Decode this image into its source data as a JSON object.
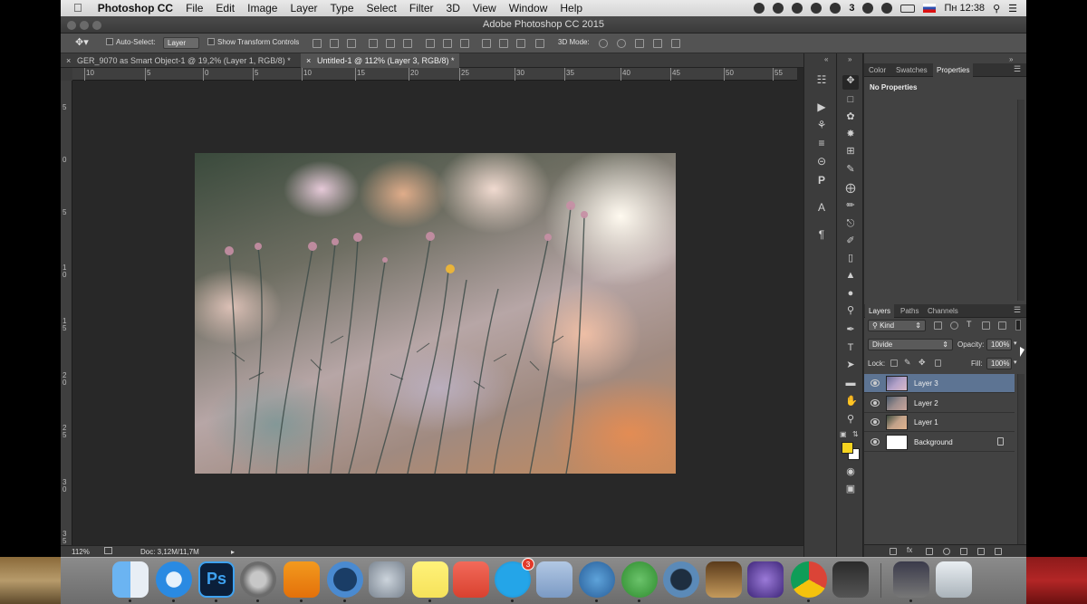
{
  "menubar": {
    "app_name": "Photoshop CC",
    "items": [
      "File",
      "Edit",
      "Image",
      "Layer",
      "Type",
      "Select",
      "Filter",
      "3D",
      "View",
      "Window",
      "Help"
    ],
    "notification_count": "3",
    "input_flag": "ru-flag-icon",
    "clock": "Пн 12:38"
  },
  "window": {
    "title": "Adobe Photoshop CC 2015"
  },
  "options_bar": {
    "auto_select_label": "Auto-Select:",
    "auto_select_value": "Layer",
    "show_transform_label": "Show Transform Controls",
    "mode_3d_label": "3D Mode:"
  },
  "tabs": [
    {
      "label": "GER_9070 as Smart Object-1 @ 19,2% (Layer 1, RGB/8) *",
      "active": false
    },
    {
      "label": "Untitled-1 @ 112% (Layer 3, RGB/8) *",
      "active": true
    }
  ],
  "ruler": {
    "h_ticks": [
      "10",
      "5",
      "0",
      "5",
      "10",
      "15",
      "20",
      "25",
      "30",
      "35",
      "40",
      "45",
      "50",
      "55"
    ],
    "v_ticks": [
      "5",
      "0",
      "5",
      "1\n0",
      "1\n5",
      "2\n0",
      "2\n5",
      "3\n0",
      "3\n5"
    ]
  },
  "status_bar": {
    "zoom": "112%",
    "doc_info": "Doc: 3,12M/11,7M"
  },
  "properties_panel": {
    "tabs": [
      "Color",
      "Swatches",
      "Properties"
    ],
    "active_tab": "Properties",
    "message": "No Properties"
  },
  "layers_panel": {
    "tabs": [
      "Layers",
      "Paths",
      "Channels"
    ],
    "active_tab": "Layers",
    "filter_kind": "Kind",
    "blend_mode": "Divide",
    "opacity_label": "Opacity:",
    "opacity_value": "100%",
    "lock_label": "Lock:",
    "fill_label": "Fill:",
    "fill_value": "100%",
    "layers": [
      {
        "name": "Layer 3",
        "selected": true,
        "locked": false
      },
      {
        "name": "Layer 2",
        "selected": false,
        "locked": false
      },
      {
        "name": "Layer 1",
        "selected": false,
        "locked": false
      },
      {
        "name": "Background",
        "selected": false,
        "locked": true
      }
    ]
  },
  "colors": {
    "foreground": "#f5d31f",
    "background": "#ffffff",
    "selected_layer": "#5d7493"
  },
  "dock": {
    "apps": [
      "finder-icon",
      "safari-icon",
      "photoshop-icon",
      "system-preferences-icon",
      "vlc-icon",
      "1password-icon",
      "launchpad-icon",
      "notes-icon",
      "pocket-icon",
      "skype-icon",
      "mail-stamp-icon",
      "messages-icon",
      "utorrent-icon",
      "quicktime-icon",
      "garageband-icon",
      "imovie-icon",
      "chrome-icon",
      "screenshot-icon",
      "desktop-icon",
      "trash-icon"
    ],
    "skype_badge": "3"
  }
}
